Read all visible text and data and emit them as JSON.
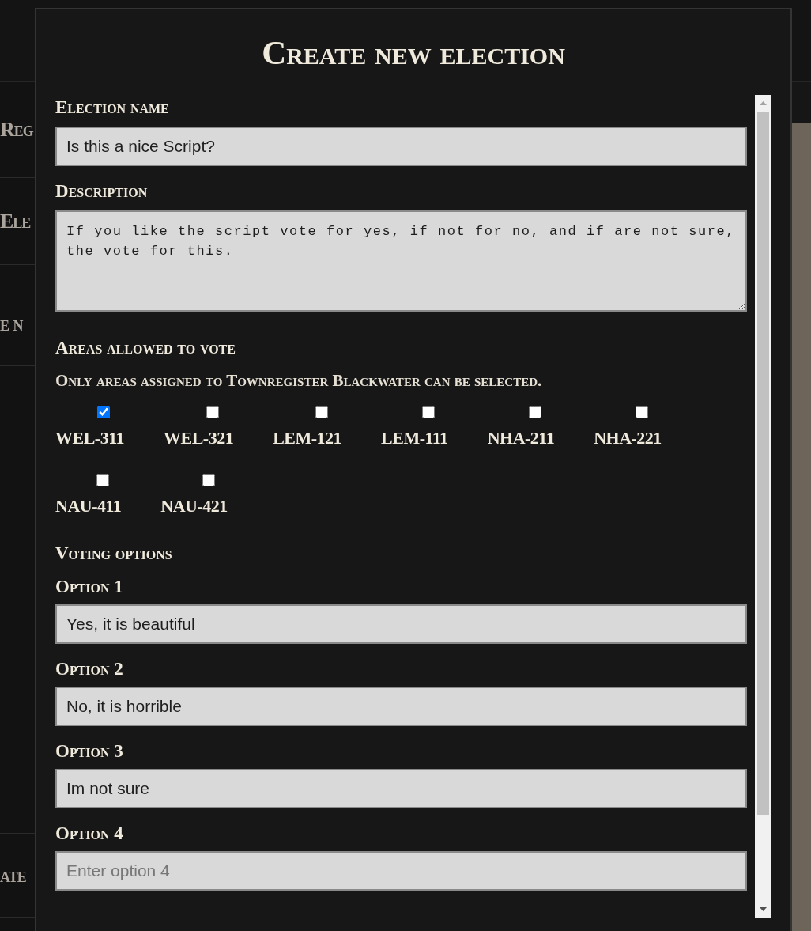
{
  "background": {
    "sidebar": [
      {
        "label": "Reg"
      },
      {
        "label": "Ele"
      },
      {
        "label": "e n"
      },
      {
        "label": "ate"
      }
    ]
  },
  "dialog": {
    "title": "Create new election",
    "fields": [
      {
        "kind": "text",
        "label": "Election name",
        "value": "Is this a nice Script?"
      },
      {
        "kind": "textarea",
        "label": "Description",
        "value": "If you like the script vote for yes, if not for no, and if are not sure, the vote for this."
      }
    ],
    "areas": {
      "label": "Areas allowed to vote",
      "note": "Only areas assigned to Townregister Blackwater can be selected.",
      "items": [
        {
          "label": "WEL-311",
          "checked": true
        },
        {
          "label": "WEL-321",
          "checked": false
        },
        {
          "label": "LEM-121",
          "checked": false
        },
        {
          "label": "LEM-111",
          "checked": false
        },
        {
          "label": "NHA-211",
          "checked": false
        },
        {
          "label": "NHA-221",
          "checked": false
        },
        {
          "label": "NAU-411",
          "checked": false
        },
        {
          "label": "NAU-421",
          "checked": false
        }
      ]
    },
    "voting_options": {
      "label": "Voting options",
      "options": [
        {
          "label": "Option 1",
          "value": "Yes, it is beautiful"
        },
        {
          "label": "Option 2",
          "value": "No, it is horrible"
        },
        {
          "label": "Option 3",
          "value": "Im not sure"
        },
        {
          "label": "Option 4",
          "placeholder": "Enter option 4"
        }
      ]
    }
  }
}
